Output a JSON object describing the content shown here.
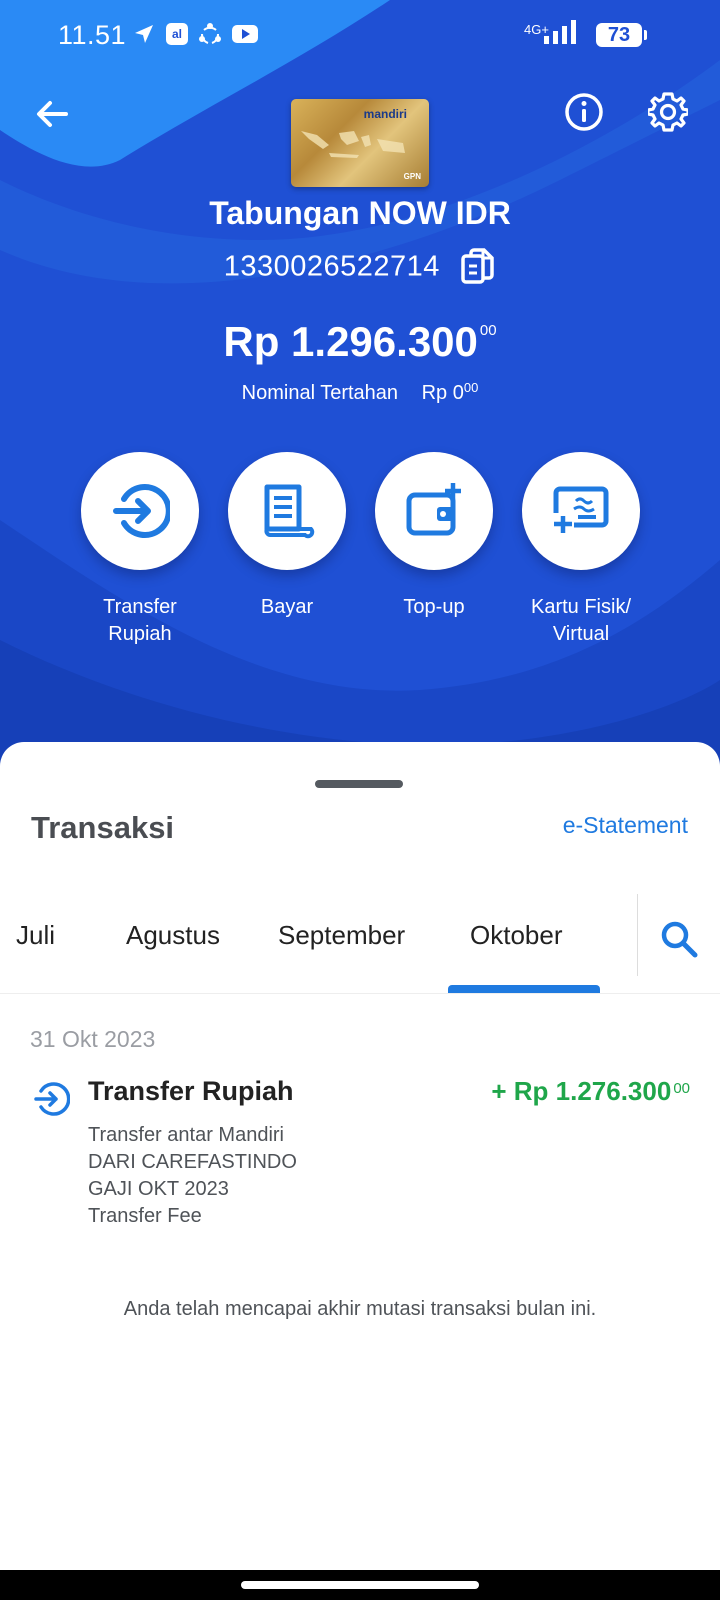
{
  "status_bar": {
    "time": "11.51",
    "network": "4G+",
    "battery": "73"
  },
  "account": {
    "card_brand": "mandiri",
    "card_network": "GPN",
    "name": "Tabungan NOW IDR",
    "number": "1330026522714",
    "balance_main": "Rp 1.296.300",
    "balance_cents": "00",
    "held_label": "Nominal Tertahan",
    "held_value": "Rp 0",
    "held_cents": "00"
  },
  "actions": [
    {
      "label": "Transfer\nRupiah",
      "icon": "transfer-icon"
    },
    {
      "label": "Bayar",
      "icon": "bill-icon"
    },
    {
      "label": "Top-up",
      "icon": "wallet-topup-icon"
    },
    {
      "label": "Kartu Fisik/\nVirtual",
      "icon": "card-add-icon"
    }
  ],
  "sheet": {
    "title": "Transaksi",
    "estatement": "e-Statement",
    "tabs": [
      "Juli",
      "Agustus",
      "September",
      "Oktober"
    ],
    "active_tab": "Oktober"
  },
  "transactions": {
    "date": "31 Okt 2023",
    "items": [
      {
        "title": "Transfer Rupiah",
        "desc": [
          "Transfer antar Mandiri",
          "DARI CAREFASTINDO",
          "GAJI OKT 2023",
          "Transfer Fee"
        ],
        "amount": "+ Rp 1.276.300",
        "amount_cents": "00"
      }
    ],
    "end_note": "Anda telah mencapai akhir mutasi transaksi bulan ini."
  },
  "colors": {
    "header_blue": "#1f50d4",
    "accent_blue": "#1f7ae0",
    "credit_green": "#1fa64a"
  }
}
